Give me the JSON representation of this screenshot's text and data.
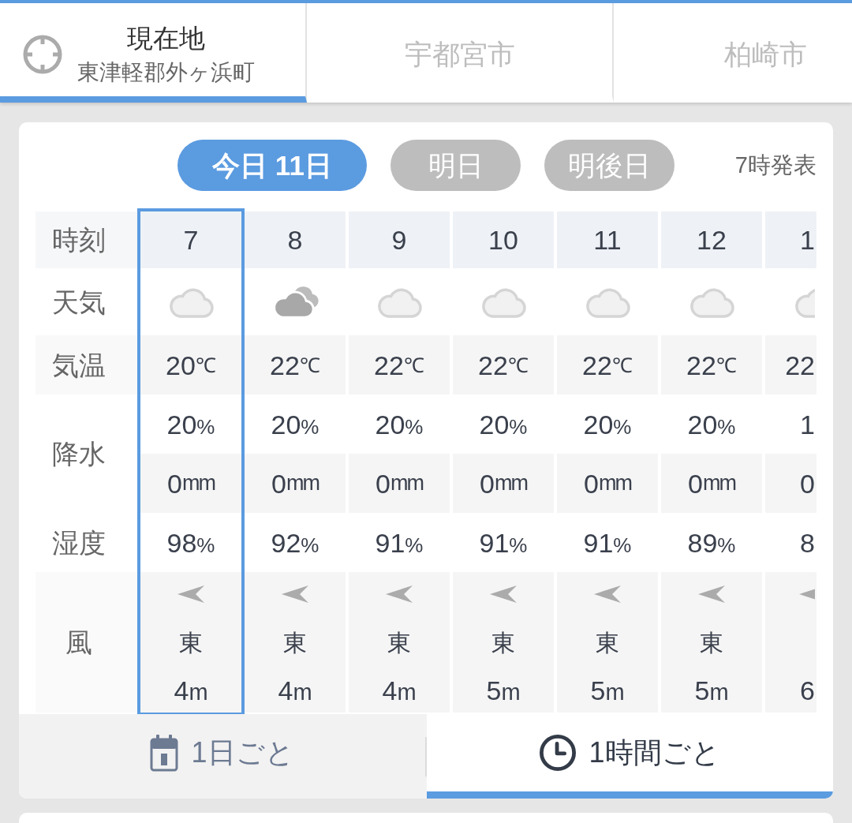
{
  "location_tabs": [
    {
      "kind": "current",
      "title": "現在地",
      "subtitle": "東津軽郡外ヶ浜町",
      "selected": true
    },
    {
      "kind": "city",
      "title": "宇都宮市",
      "selected": false
    },
    {
      "kind": "city",
      "title": "柏崎市",
      "selected": false
    }
  ],
  "forecast": {
    "days": [
      {
        "label": "今日 11日",
        "selected": true
      },
      {
        "label": "明日",
        "selected": false
      },
      {
        "label": "明後日",
        "selected": false
      }
    ],
    "issued": "7時発表",
    "rows": [
      {
        "kind": "hour",
        "label": "時刻"
      },
      {
        "kind": "weather",
        "label": "天気"
      },
      {
        "kind": "temp",
        "label": "気温"
      },
      {
        "kind": "precip",
        "label": "降水"
      },
      {
        "kind": "humidity",
        "label": "湿度"
      },
      {
        "kind": "wind",
        "label": "風"
      }
    ],
    "hours": [
      {
        "kind": "full",
        "selected": true,
        "hour": "7",
        "weather": {
          "kind": "cloudy"
        },
        "temp": {
          "value": "20",
          "unit": "℃"
        },
        "precip_chance": {
          "value": "20",
          "unit": "%"
        },
        "precip_amount": {
          "value": "0",
          "unit": "mm"
        },
        "humidity": {
          "value": "98",
          "unit": "%"
        },
        "wind_dir": "東",
        "wind_speed": {
          "value": "4",
          "unit": "m"
        }
      },
      {
        "kind": "full",
        "selected": false,
        "hour": "8",
        "weather": {
          "kind": "overcast"
        },
        "temp": {
          "value": "22",
          "unit": "℃"
        },
        "precip_chance": {
          "value": "20",
          "unit": "%"
        },
        "precip_amount": {
          "value": "0",
          "unit": "mm"
        },
        "humidity": {
          "value": "92",
          "unit": "%"
        },
        "wind_dir": "東",
        "wind_speed": {
          "value": "4",
          "unit": "m"
        }
      },
      {
        "kind": "full",
        "selected": false,
        "hour": "9",
        "weather": {
          "kind": "cloudy"
        },
        "temp": {
          "value": "22",
          "unit": "℃"
        },
        "precip_chance": {
          "value": "20",
          "unit": "%"
        },
        "precip_amount": {
          "value": "0",
          "unit": "mm"
        },
        "humidity": {
          "value": "91",
          "unit": "%"
        },
        "wind_dir": "東",
        "wind_speed": {
          "value": "4",
          "unit": "m"
        }
      },
      {
        "kind": "full",
        "selected": false,
        "hour": "10",
        "weather": {
          "kind": "cloudy"
        },
        "temp": {
          "value": "22",
          "unit": "℃"
        },
        "precip_chance": {
          "value": "20",
          "unit": "%"
        },
        "precip_amount": {
          "value": "0",
          "unit": "mm"
        },
        "humidity": {
          "value": "91",
          "unit": "%"
        },
        "wind_dir": "東",
        "wind_speed": {
          "value": "5",
          "unit": "m"
        }
      },
      {
        "kind": "full",
        "selected": false,
        "hour": "11",
        "weather": {
          "kind": "cloudy"
        },
        "temp": {
          "value": "22",
          "unit": "℃"
        },
        "precip_chance": {
          "value": "20",
          "unit": "%"
        },
        "precip_amount": {
          "value": "0",
          "unit": "mm"
        },
        "humidity": {
          "value": "91",
          "unit": "%"
        },
        "wind_dir": "東",
        "wind_speed": {
          "value": "5",
          "unit": "m"
        }
      },
      {
        "kind": "full",
        "selected": false,
        "hour": "12",
        "weather": {
          "kind": "cloudy"
        },
        "temp": {
          "value": "22",
          "unit": "℃"
        },
        "precip_chance": {
          "value": "20",
          "unit": "%"
        },
        "precip_amount": {
          "value": "0",
          "unit": "mm"
        },
        "humidity": {
          "value": "89",
          "unit": "%"
        },
        "wind_dir": "東",
        "wind_speed": {
          "value": "5",
          "unit": "m"
        }
      },
      {
        "kind": "cut",
        "selected": false,
        "hour": "1",
        "weather": {
          "kind": "cloudy"
        },
        "temp": {
          "value": "22"
        },
        "precip_chance": {
          "value": "1"
        },
        "precip_amount": {
          "value": "0"
        },
        "humidity": {
          "value": "8"
        },
        "wind_speed": {
          "value": "6"
        }
      }
    ]
  },
  "view_tabs": [
    {
      "kind": "daily",
      "label": "1日ごと",
      "selected": false
    },
    {
      "kind": "hourly",
      "label": "1時間ごと",
      "selected": true
    }
  ]
}
